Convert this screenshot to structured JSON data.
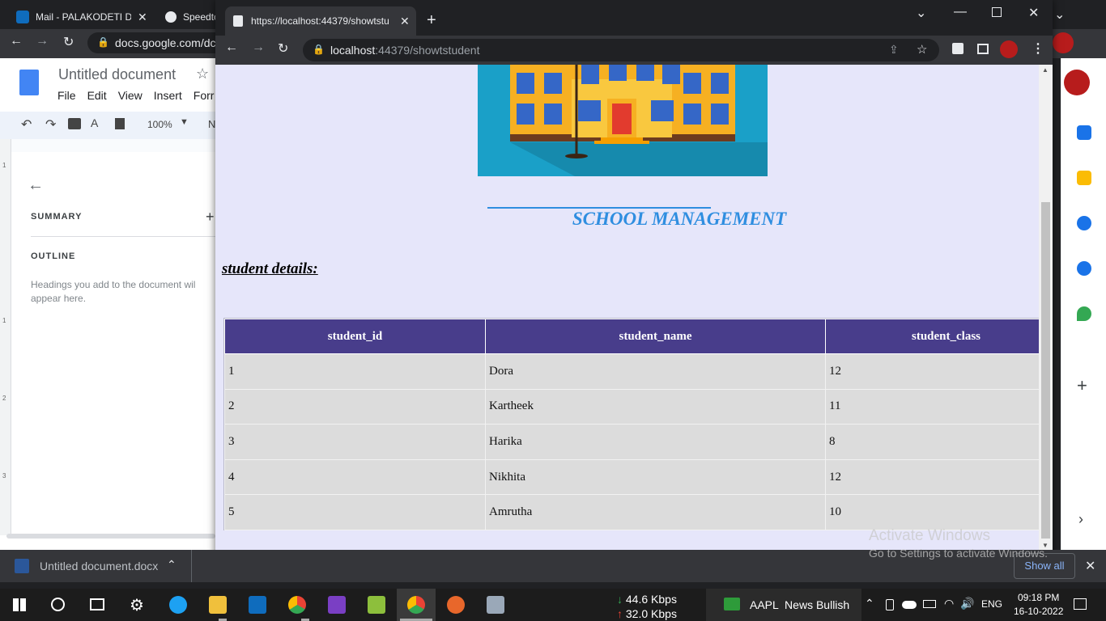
{
  "background_browser": {
    "tabs": [
      {
        "label": "Mail - PALAKODETI DC"
      },
      {
        "label": "Speedtc"
      }
    ],
    "url": "docs.google.com/dc"
  },
  "docs": {
    "title": "Untitled document",
    "menu": [
      "File",
      "Edit",
      "View",
      "Insert",
      "Forr"
    ],
    "zoom": "100%",
    "font_stub": "N",
    "outline": {
      "summary": "SUMMARY",
      "outline_label": "OUTLINE",
      "hint": "Headings you add to the document wil appear here."
    },
    "ruler_numbers": [
      "1",
      "1",
      "2",
      "3"
    ]
  },
  "popup": {
    "tab_title": "https://localhost:44379/showtstu",
    "url_host": "localhost",
    "url_rest": ":44379/showtstudent"
  },
  "page": {
    "heading": "SCHOOL MANAGEMENT",
    "subheading": "student details:",
    "table": {
      "headers": [
        "student_id",
        "student_name",
        "student_class"
      ],
      "rows": [
        [
          "1",
          "Dora",
          "12"
        ],
        [
          "2",
          "Kartheek",
          "11"
        ],
        [
          "3",
          "Harika",
          "8"
        ],
        [
          "4",
          "Nikhita",
          "12"
        ],
        [
          "5",
          "Amrutha",
          "10"
        ]
      ]
    }
  },
  "watermark": {
    "line1": "Activate Windows",
    "line2": "Go to Settings to activate Windows."
  },
  "download_bar": {
    "file": "Untitled document.docx",
    "show_all": "Show all"
  },
  "taskbar": {
    "net_down": "44.6 Kbps",
    "net_up": "32.0 Kbps",
    "news": "AAPL  News Bullish",
    "lang": "ENG",
    "time": "09:18 PM",
    "date": "16-10-2022"
  },
  "colors": {
    "table_header": "#483d8b",
    "page_bg": "#e6e6fa",
    "title_blue": "#2f8ee0"
  }
}
